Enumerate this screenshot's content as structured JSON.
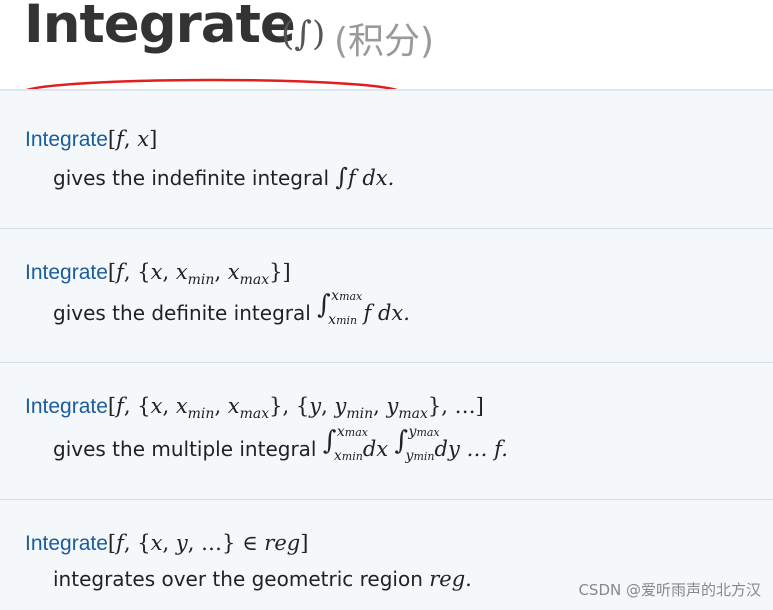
{
  "header": {
    "title": "Integrate",
    "symbol": "(∫)",
    "subtitle_cn": "(积分)"
  },
  "entries": [
    {
      "fn": "Integrate",
      "args": "[f, x]",
      "desc_text": "gives the indefinite integral",
      "integrand": "f dx."
    },
    {
      "fn": "Integrate",
      "args_pre": "[f, {x, x",
      "args_sub1": "min",
      "args_mid": ", x",
      "args_sub2": "max",
      "args_post": "}]",
      "desc_text": "gives the definite integral",
      "lim_upper": "x max",
      "lim_lower": "x min",
      "integrand": "f dx."
    },
    {
      "fn": "Integrate",
      "args": "[f, {x, x min, x max}, {y, y min, y max}, …]",
      "desc_text": "gives the multiple integral",
      "lim1_upper": "x max",
      "lim1_lower": "x min",
      "mid": "dx",
      "lim2_upper": "y max",
      "lim2_lower": "y min",
      "integrand": "dy … f."
    },
    {
      "fn": "Integrate",
      "args": "[f, {x, y, …} ∈ reg]",
      "desc_text": "integrates over the geometric region",
      "region": "reg."
    }
  ],
  "watermark": "CSDN @爱听雨声的北方汉",
  "colors": {
    "function_link": "#1a5c9c",
    "annotation": "#e02020",
    "entries_bg": "#f4f8fb"
  }
}
